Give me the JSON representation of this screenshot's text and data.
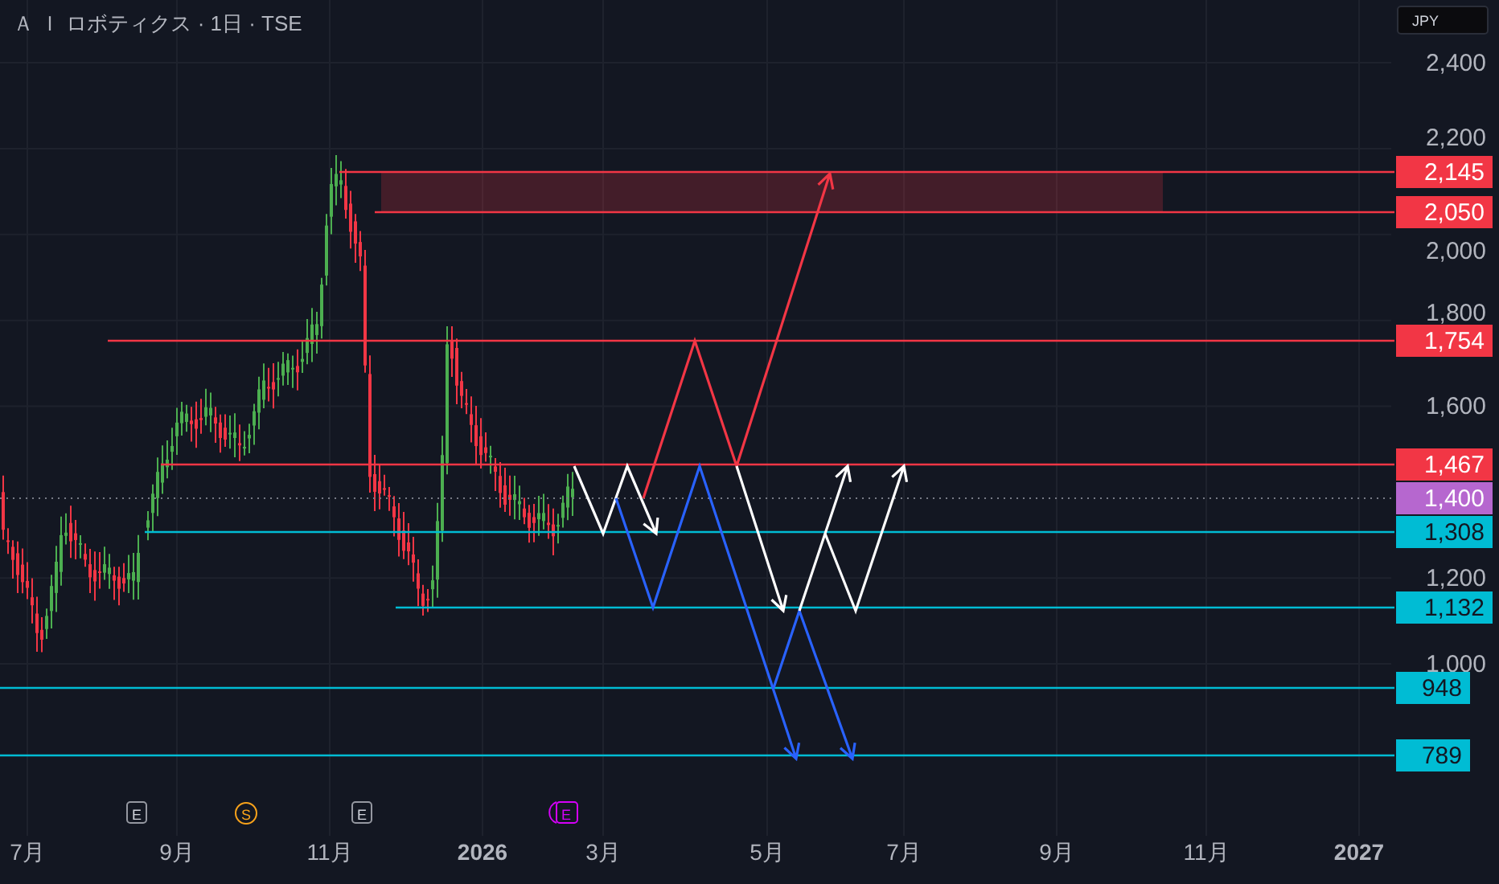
{
  "title": "Ａ Ｉ ロボティクス · 1日 · TSE",
  "currency": "JPY",
  "y_ticks": [
    "2,400",
    "2,200",
    "2,000",
    "1,800",
    "1,600",
    "1,200",
    "1,000"
  ],
  "x_ticks": [
    {
      "label": "7月",
      "bold": false
    },
    {
      "label": "9月",
      "bold": false
    },
    {
      "label": "11月",
      "bold": false
    },
    {
      "label": "2026",
      "bold": true
    },
    {
      "label": "3月",
      "bold": false
    },
    {
      "label": "5月",
      "bold": false
    },
    {
      "label": "7月",
      "bold": false
    },
    {
      "label": "9月",
      "bold": false
    },
    {
      "label": "11月",
      "bold": false
    },
    {
      "label": "2027",
      "bold": true
    }
  ],
  "events": [
    {
      "kind": "earnings",
      "label": "E"
    },
    {
      "kind": "dividend",
      "label": "S"
    },
    {
      "kind": "earnings",
      "label": "E"
    },
    {
      "kind": "earnings_upcoming",
      "label": "E"
    }
  ],
  "levels": [
    {
      "price": "2,145",
      "kind": "resistance",
      "color": "#f23645"
    },
    {
      "price": "2,050",
      "kind": "resistance",
      "color": "#f23645"
    },
    {
      "price": "1,754",
      "kind": "resistance",
      "color": "#f23645"
    },
    {
      "price": "1,467",
      "kind": "resistance",
      "color": "#f23645"
    },
    {
      "price": "1,400",
      "kind": "current",
      "color": "#b667cf"
    },
    {
      "price": "1,308",
      "kind": "support",
      "color": "#00bcd4"
    },
    {
      "price": "1,132",
      "kind": "support",
      "color": "#00bcd4"
    },
    {
      "price": "948",
      "kind": "support",
      "color": "#00bcd4"
    },
    {
      "price": "789",
      "kind": "support",
      "color": "#00bcd4"
    }
  ]
}
